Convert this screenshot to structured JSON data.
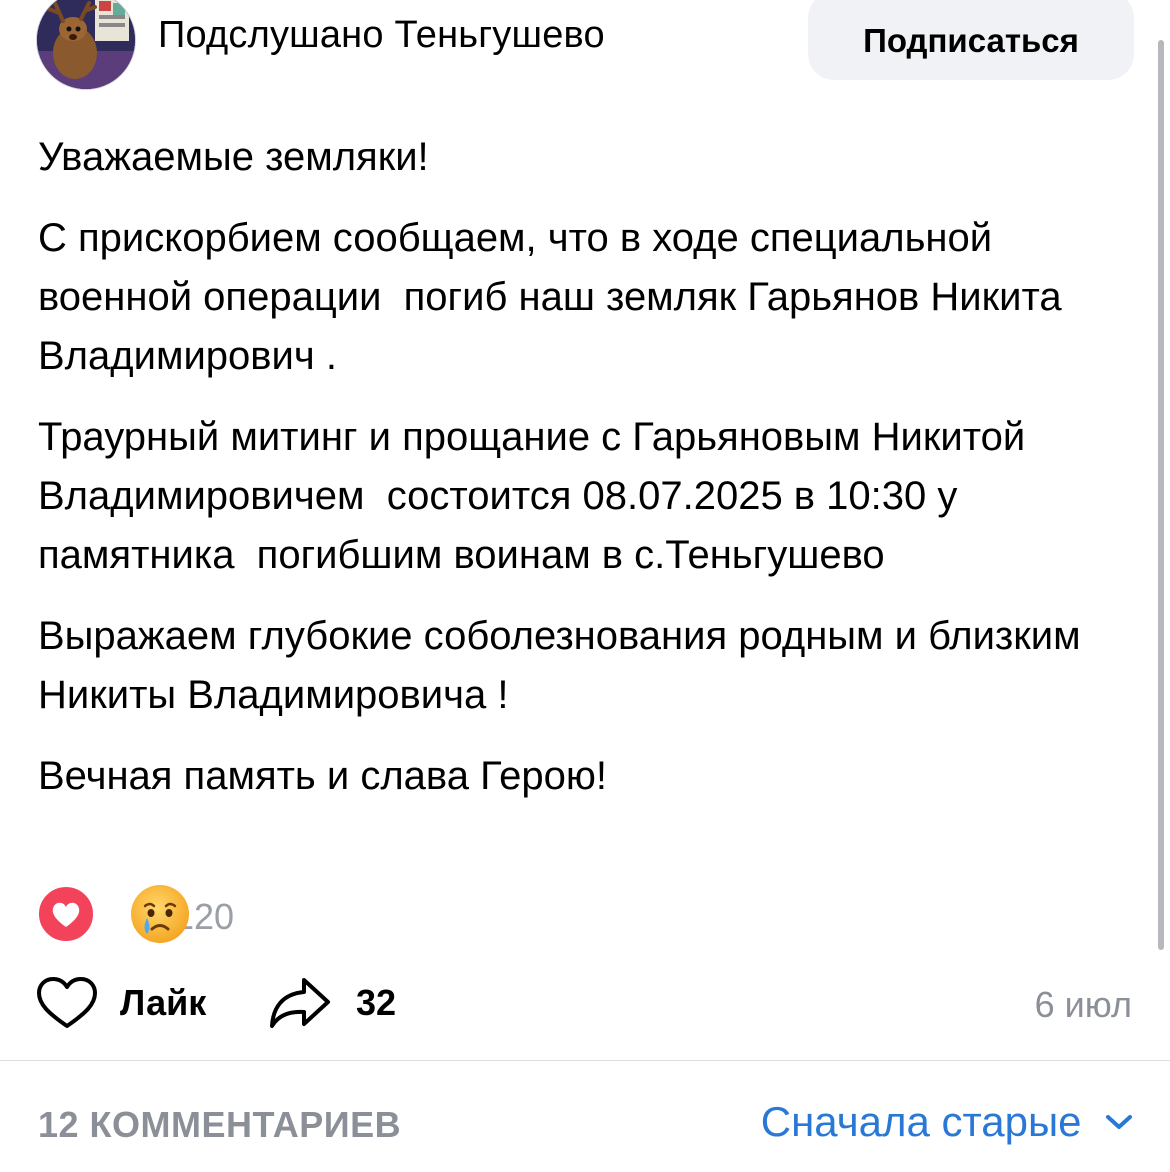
{
  "header": {
    "group_name": "Подслушано Теньгушево",
    "subscribe_label": "Подписаться"
  },
  "post": {
    "paragraphs": [
      "Уважаемые земляки!",
      "С прискорбием сообщаем, что в ходе специальной военной операции  погиб наш земляк Гарьянов Никита Владимирович .",
      "Траурный митинг и прощание с Гарьяновым Никитой Владимировичем  состоится 08.07.2025 в 10:30 у памятника  погибшим воинам в с.Теньгушево",
      "Выражаем глубокие соболезнования родным и близким  Никиты Владимировича !",
      "Вечная память и слава Герою!"
    ]
  },
  "reactions": {
    "icons": [
      "heart-icon",
      "crying-face-icon"
    ],
    "count": "120"
  },
  "actions": {
    "like_label": "Лайк",
    "share_count": "32",
    "date": "6 июл"
  },
  "comments": {
    "count_label": "12 КОММЕНТАРИЕВ",
    "sort_label": "Сначала старые"
  },
  "colors": {
    "accent": "#2a78d6",
    "heart": "#f2435b",
    "muted": "#8b8f97",
    "button_bg": "#f1f2f5"
  }
}
